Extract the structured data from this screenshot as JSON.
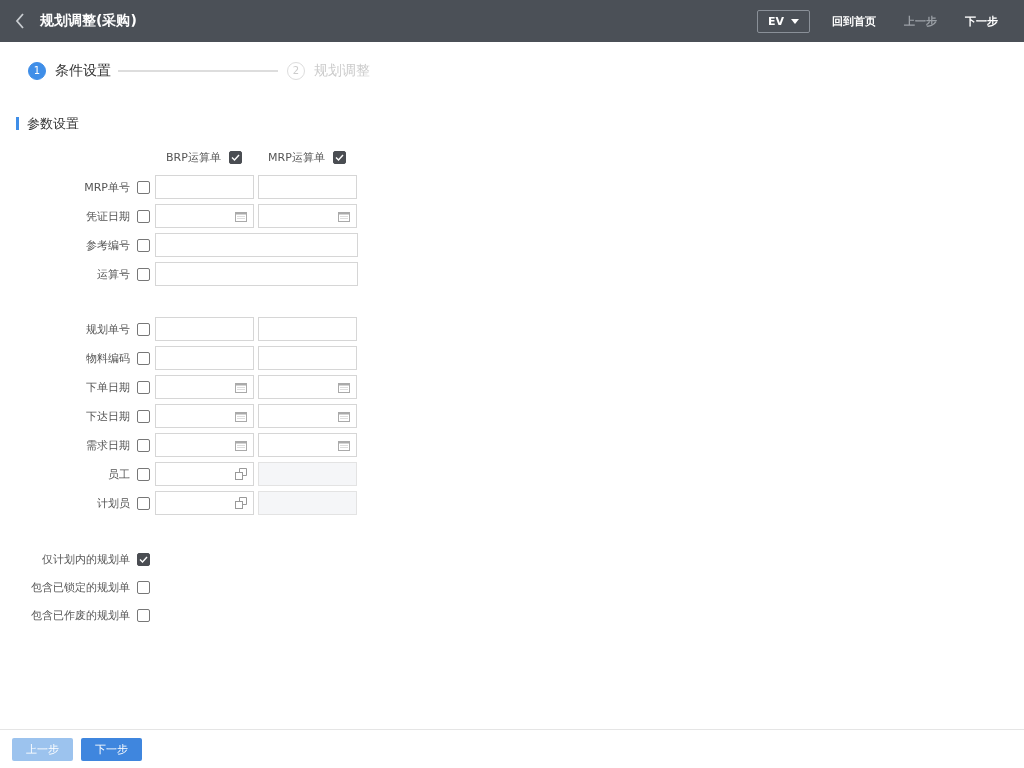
{
  "header": {
    "title": "规划调整(采购)",
    "language": "EV",
    "actions": [
      {
        "label": "回到首页",
        "disabled": false
      },
      {
        "label": "上一步",
        "disabled": true
      },
      {
        "label": "下一步",
        "disabled": false
      }
    ]
  },
  "steps": [
    {
      "number": "1",
      "label": "条件设置",
      "selected": true
    },
    {
      "number": "2",
      "label": "规划调整",
      "selected": false
    }
  ],
  "section_title": "参数设置",
  "column_headers": [
    {
      "label": "BRP运算单",
      "checked": true
    },
    {
      "label": "MRP运算单",
      "checked": true
    }
  ],
  "field_groups": [
    {
      "rows": [
        {
          "label": "MRP单号",
          "checked": false,
          "kind": "text-pair"
        },
        {
          "label": "凭证日期",
          "checked": false,
          "kind": "date-pair"
        },
        {
          "label": "参考编号",
          "checked": false,
          "kind": "text-wide"
        },
        {
          "label": "运算号",
          "checked": false,
          "kind": "text-wide"
        }
      ]
    },
    {
      "rows": [
        {
          "label": "规划单号",
          "checked": false,
          "kind": "text-pair"
        },
        {
          "label": "物料编码",
          "checked": false,
          "kind": "text-pair"
        },
        {
          "label": "下单日期",
          "checked": false,
          "kind": "date-pair"
        },
        {
          "label": "下达日期",
          "checked": false,
          "kind": "date-pair"
        },
        {
          "label": "需求日期",
          "checked": false,
          "kind": "date-pair"
        },
        {
          "label": "员工",
          "checked": false,
          "kind": "picker"
        },
        {
          "label": "计划员",
          "checked": false,
          "kind": "picker"
        }
      ]
    }
  ],
  "options": [
    {
      "label": "仅计划内的规划单",
      "checked": true
    },
    {
      "label": "包含已锁定的规划单",
      "checked": false
    },
    {
      "label": "包含已作废的规划单",
      "checked": false
    }
  ],
  "footer_buttons": [
    {
      "label": "上一步",
      "disabled": true
    },
    {
      "label": "下一步",
      "disabled": false
    }
  ]
}
